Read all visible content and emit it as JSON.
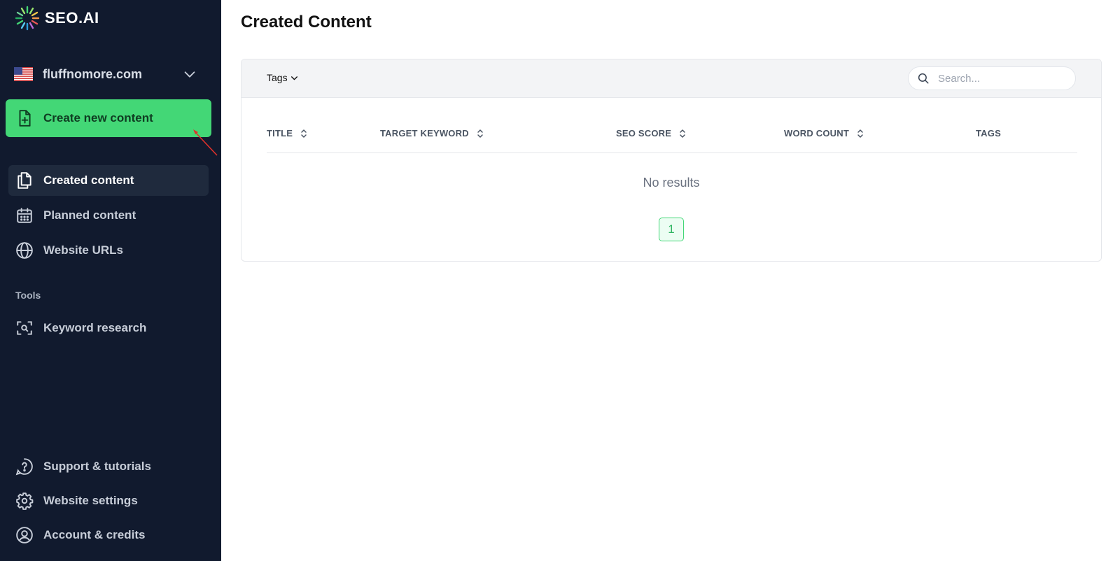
{
  "brand": {
    "name": "SEO.AI"
  },
  "site_selector": {
    "site": "fluffnomore.com"
  },
  "sidebar": {
    "create_button": "Create new content",
    "nav": [
      {
        "label": "Created content",
        "icon": "documents-icon",
        "active": true
      },
      {
        "label": "Planned content",
        "icon": "calendar-icon",
        "active": false
      },
      {
        "label": "Website URLs",
        "icon": "globe-icon",
        "active": false
      }
    ],
    "tools_section": "Tools",
    "tools": [
      {
        "label": "Keyword research",
        "icon": "scan-search-icon"
      }
    ],
    "bottom": [
      {
        "label": "Support & tutorials",
        "icon": "help-circle-icon"
      },
      {
        "label": "Website settings",
        "icon": "gear-icon"
      },
      {
        "label": "Account & credits",
        "icon": "user-circle-icon"
      }
    ]
  },
  "main": {
    "title": "Created Content",
    "filters": {
      "tags_label": "Tags"
    },
    "search": {
      "placeholder": "Search..."
    },
    "columns": [
      "TITLE",
      "TARGET KEYWORD",
      "SEO SCORE",
      "WORD COUNT",
      "TAGS"
    ],
    "empty_message": "No results",
    "pagination": {
      "current_page": "1"
    }
  },
  "colors": {
    "sidebar_bg": "#111a2e",
    "accent_green": "#43d776"
  }
}
